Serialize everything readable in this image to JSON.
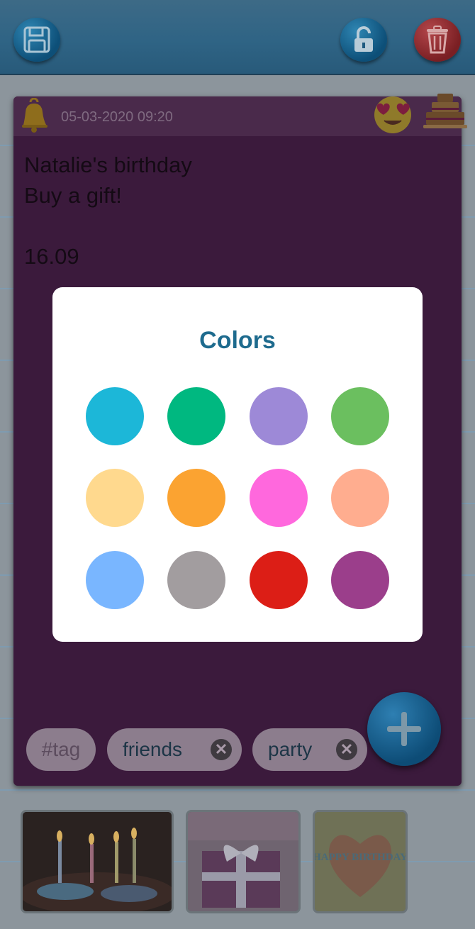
{
  "note": {
    "datetime": "05-03-2020 09:20",
    "lines": [
      "Natalie's birthday",
      "Buy a gift!",
      "",
      "16.09"
    ]
  },
  "tags": {
    "placeholder": "#tag",
    "chips": [
      {
        "label": "friends"
      },
      {
        "label": "party"
      }
    ]
  },
  "dialog": {
    "title": "Colors",
    "colors": [
      "#1cb7d8",
      "#00b880",
      "#9d89d7",
      "#6bbf5f",
      "#ffd98e",
      "#fba331",
      "#ff68dd",
      "#ffad8f",
      "#79b6ff",
      "#a29d9f",
      "#dc1e16",
      "#9b3e8b"
    ]
  },
  "icons": {
    "save": "floppy-disk-icon",
    "lock": "unlock-icon",
    "delete": "trash-icon",
    "bell": "bell-icon",
    "emoji": "heart-eyes-emoji-icon",
    "cake": "birthday-cake-icon",
    "add": "plus-icon"
  },
  "thumbnails": [
    {
      "name": "birthday-candles"
    },
    {
      "name": "gift-box"
    },
    {
      "name": "happy-birthday-card",
      "caption": "HAPPY BIRTHDAY"
    }
  ]
}
